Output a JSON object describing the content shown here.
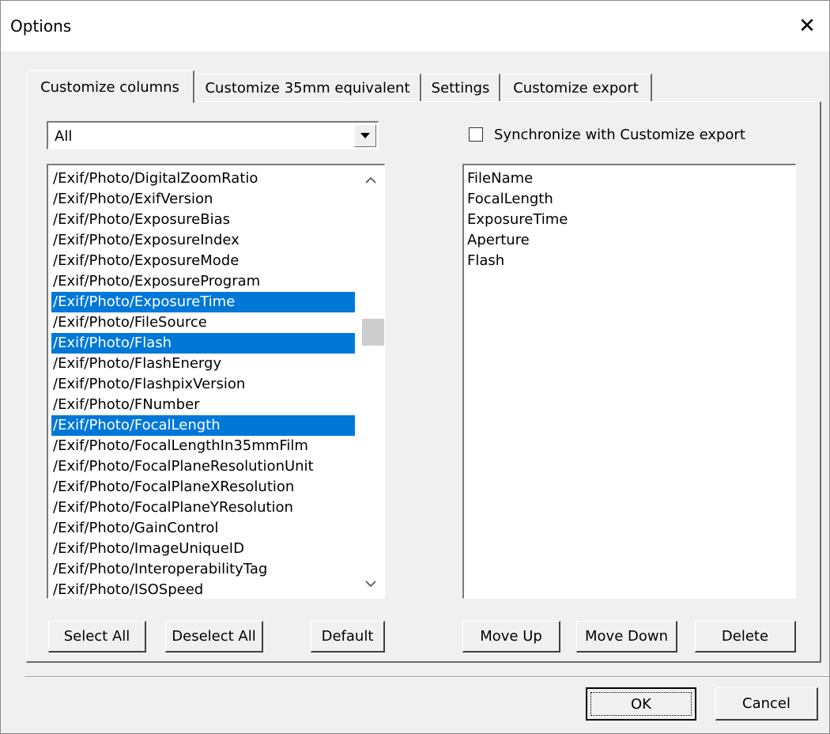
{
  "window": {
    "title": "Options",
    "close_glyph": "✕"
  },
  "tabs": [
    {
      "label": "Customize columns",
      "active": true
    },
    {
      "label": "Customize 35mm equivalent",
      "active": false
    },
    {
      "label": "Settings",
      "active": false
    },
    {
      "label": "Customize export",
      "active": false
    }
  ],
  "filter": {
    "selected": "All"
  },
  "available_fields": [
    {
      "label": "/Exif/Photo/DigitalZoomRatio",
      "selected": false
    },
    {
      "label": "/Exif/Photo/ExifVersion",
      "selected": false
    },
    {
      "label": "/Exif/Photo/ExposureBias",
      "selected": false
    },
    {
      "label": "/Exif/Photo/ExposureIndex",
      "selected": false
    },
    {
      "label": "/Exif/Photo/ExposureMode",
      "selected": false
    },
    {
      "label": "/Exif/Photo/ExposureProgram",
      "selected": false
    },
    {
      "label": "/Exif/Photo/ExposureTime",
      "selected": true
    },
    {
      "label": "/Exif/Photo/FileSource",
      "selected": false
    },
    {
      "label": "/Exif/Photo/Flash",
      "selected": true
    },
    {
      "label": "/Exif/Photo/FlashEnergy",
      "selected": false
    },
    {
      "label": "/Exif/Photo/FlashpixVersion",
      "selected": false
    },
    {
      "label": "/Exif/Photo/FNumber",
      "selected": false
    },
    {
      "label": "/Exif/Photo/FocalLength",
      "selected": true
    },
    {
      "label": "/Exif/Photo/FocalLengthIn35mmFilm",
      "selected": false
    },
    {
      "label": "/Exif/Photo/FocalPlaneResolutionUnit",
      "selected": false
    },
    {
      "label": "/Exif/Photo/FocalPlaneXResolution",
      "selected": false
    },
    {
      "label": "/Exif/Photo/FocalPlaneYResolution",
      "selected": false
    },
    {
      "label": "/Exif/Photo/GainControl",
      "selected": false
    },
    {
      "label": "/Exif/Photo/ImageUniqueID",
      "selected": false
    },
    {
      "label": "/Exif/Photo/InteroperabilityTag",
      "selected": false
    },
    {
      "label": "/Exif/Photo/ISOSpeed",
      "selected": false
    }
  ],
  "sync": {
    "label": "Synchronize with Customize export",
    "checked": false
  },
  "chosen_columns": [
    "FileName",
    "FocalLength",
    "ExposureTime",
    "Aperture",
    "Flash"
  ],
  "left_buttons": {
    "select_all": "Select All",
    "deselect_all": "Deselect All",
    "default": "Default"
  },
  "right_buttons": {
    "move_up": "Move Up",
    "move_down": "Move Down",
    "delete": "Delete"
  },
  "footer": {
    "ok": "OK",
    "cancel": "Cancel"
  },
  "colors": {
    "selection": "#0078d7",
    "face": "#f0f0f0"
  },
  "icons": {
    "scroll_up": "chevron-up-icon",
    "scroll_down": "chevron-down-icon",
    "dropdown": "triangle-down-icon",
    "close": "close-icon"
  }
}
